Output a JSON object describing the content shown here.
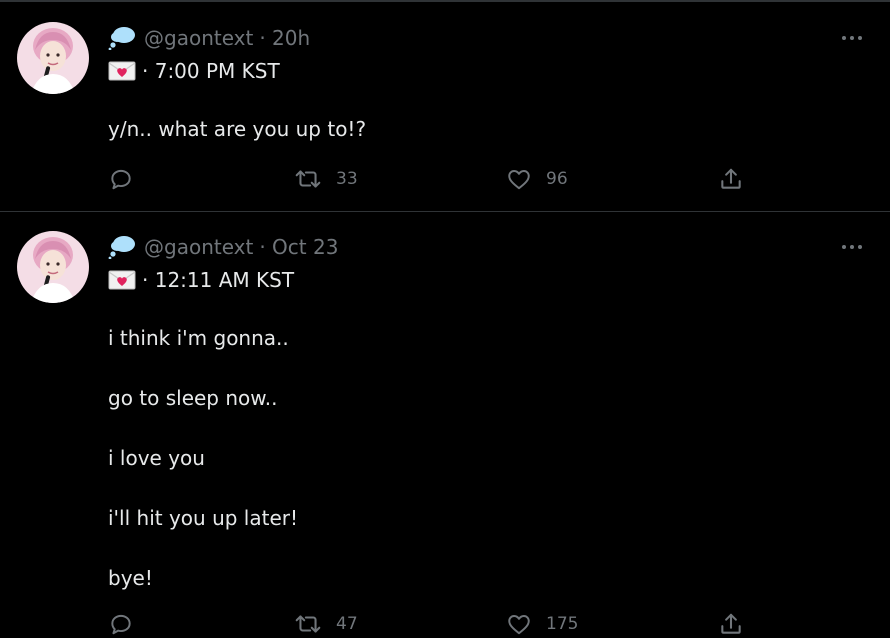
{
  "tweets": [
    {
      "handle": "@gaontext",
      "time": "· 20h",
      "subtitle": "· 7:00 PM KST",
      "body": [
        "y/n.. what are you up to!?"
      ],
      "reply_count": "",
      "retweet_count": "33",
      "like_count": "96"
    },
    {
      "handle": "@gaontext",
      "time": "· Oct 23",
      "subtitle": "· 12:11 AM KST",
      "body": [
        "i think i'm gonna..",
        "go to sleep now..",
        "i love you",
        "i'll hit you up later!",
        "bye!"
      ],
      "reply_count": "",
      "retweet_count": "47",
      "like_count": "175"
    }
  ],
  "icons": {
    "header_emoji": "thought-balloon-icon",
    "subtitle_emoji": "love-letter-icon",
    "reply": "reply-icon",
    "retweet": "retweet-icon",
    "like": "heart-icon",
    "share": "share-icon",
    "more": "more-icon"
  },
  "colors": {
    "background": "#000000",
    "text": "#e7e9ea",
    "muted": "#71767b",
    "divider": "#2f3336",
    "balloon": "#aee0fb",
    "heart": "#e0245e"
  }
}
